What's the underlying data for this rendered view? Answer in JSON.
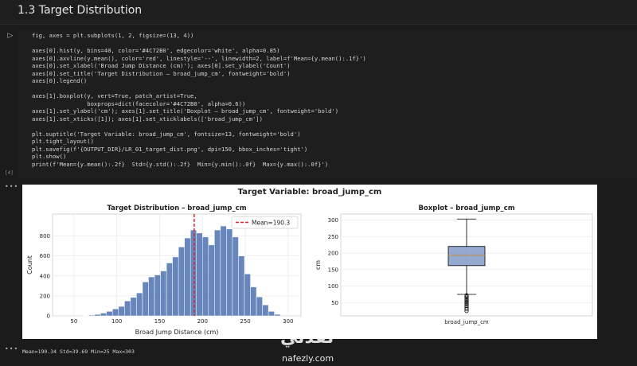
{
  "heading": {
    "title": "1.3 Target Distribution"
  },
  "cell": {
    "exec_count": "[4]",
    "run_icon": "play-icon",
    "code_lines": [
      "fig, axes = plt.subplots(1, 2, figsize=(13, 4))",
      "",
      "axes[0].hist(y, bins=40, color='#4C72B0', edgecolor='white', alpha=0.85)",
      "axes[0].axvline(y.mean(), color='red', linestyle='--', linewidth=2, label=f'Mean={y.mean():.1f}')",
      "axes[0].set_xlabel('Broad Jump Distance (cm)'); axes[0].set_ylabel('Count')",
      "axes[0].set_title('Target Distribution – broad_jump_cm', fontweight='bold')",
      "axes[0].legend()",
      "",
      "axes[1].boxplot(y, vert=True, patch_artist=True,",
      "                boxprops=dict(facecolor='#4C72B0', alpha=0.6))",
      "axes[1].set_ylabel('cm'); axes[1].set_title('Boxplot – broad_jump_cm', fontweight='bold')",
      "axes[1].set_xticks([1]); axes[1].set_xticklabels(['broad_jump_cm'])",
      "",
      "plt.suptitle('Target Variable: broad_jump_cm', fontsize=13, fontweight='bold')",
      "plt.tight_layout()",
      "plt.savefig(f'{OUTPUT_DIR}/LR_01_target_dist.png', dpi=150, bbox_inches='tight')",
      "plt.show()",
      "print(f'Mean={y.mean():.2f}  Std={y.std():.2f}  Min={y.min():.0f}  Max={y.max():.0f}')"
    ]
  },
  "output": {
    "more_icon": "ellipsis-icon",
    "print_text": "Mean=190.34  Std=39.69  Min=25  Max=303"
  },
  "watermark": {
    "arabic": "نفذلي",
    "latin": "nafezly.com"
  },
  "chart_data": [
    {
      "type": "bar",
      "suptitle": "Target Variable: broad_jump_cm",
      "title": "Target Distribution – broad_jump_cm",
      "xlabel": "Broad Jump Distance (cm)",
      "ylabel": "Count",
      "xlim": [
        25,
        315
      ],
      "ylim": [
        0,
        1020
      ],
      "xticks": [
        50,
        100,
        150,
        200,
        250,
        300
      ],
      "yticks": [
        0,
        200,
        400,
        600,
        800
      ],
      "bar_color": "#4C72B0",
      "bin_edges": [
        60,
        67,
        74,
        81,
        88,
        95,
        102,
        109,
        116,
        123,
        130,
        137,
        144,
        151,
        158,
        165,
        172,
        179,
        186,
        193,
        200,
        207,
        214,
        221,
        228,
        235,
        242,
        249,
        256,
        263,
        270,
        277,
        284,
        291
      ],
      "counts": [
        3,
        8,
        15,
        28,
        45,
        70,
        95,
        150,
        185,
        230,
        340,
        390,
        410,
        450,
        530,
        590,
        690,
        780,
        860,
        830,
        790,
        710,
        860,
        900,
        870,
        790,
        600,
        420,
        290,
        190,
        110,
        45,
        15
      ],
      "mean_line": {
        "x": 190.3,
        "color": "#d62728",
        "label": "Mean=190.3"
      },
      "legend": "top-right",
      "grid": true
    },
    {
      "type": "boxplot",
      "title": "Boxplot – broad_jump_cm",
      "ylabel": "cm",
      "category": "broad_jump_cm",
      "ylim": [
        10,
        318
      ],
      "yticks": [
        50,
        100,
        150,
        200,
        250,
        300
      ],
      "box": {
        "whisker_low": 75,
        "q1": 162,
        "median": 193,
        "q3": 220,
        "whisker_high": 303
      },
      "outliers": [
        72,
        68,
        65,
        60,
        56,
        52,
        48,
        44,
        40,
        35,
        30,
        25
      ],
      "box_color": "#4C72B0",
      "grid": true
    }
  ]
}
